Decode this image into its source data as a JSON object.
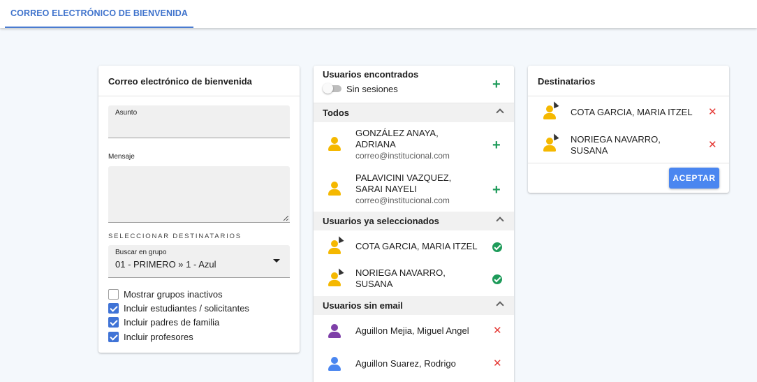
{
  "tab": {
    "label": "CORREO ELECTRÓNICO DE BIENVENIDA"
  },
  "welcome": {
    "title": "Correo electrónico de bienvenida",
    "subject_label": "Asunto",
    "subject_value": "",
    "message_label": "Mensaje",
    "message_value": "",
    "recipients_caption": "SELECCIONAR DESTINATARIOS",
    "group_select": {
      "label": "Buscar en grupo",
      "value": "01 - PRIMERO » 1 - Azul"
    },
    "checkboxes": [
      {
        "label": "Mostrar grupos inactivos",
        "checked": false
      },
      {
        "label": "Incluir estudiantes / solicitantes",
        "checked": true
      },
      {
        "label": "Incluir padres de familia",
        "checked": true
      },
      {
        "label": "Incluir profesores",
        "checked": true
      }
    ]
  },
  "users": {
    "title": "Usuarios encontrados",
    "toggle_label": "Sin sesiones",
    "toggle_on": false,
    "add_icon": "plus-icon",
    "groups": {
      "todos": {
        "label": "Todos",
        "items": [
          {
            "name_line1": "GONZÁLEZ ANAYA,",
            "name_line2": "ADRIANA",
            "email": "correo@institucional.com"
          },
          {
            "name_line1": "PALAVICINI VAZQUEZ,",
            "name_line2": "SARAI NAYELI",
            "email": "correo@institucional.com"
          }
        ]
      },
      "selected": {
        "label": "Usuarios ya seleccionados",
        "items": [
          {
            "name_line1": "COTA GARCIA, MARIA ITZEL"
          },
          {
            "name_line1": "NORIEGA NAVARRO,",
            "name_line2": "SUSANA"
          }
        ]
      },
      "no_email": {
        "label": "Usuarios sin email",
        "items": [
          {
            "name_line1": "Aguillon Mejia, Miguel Angel"
          },
          {
            "name_line1": "Aguillon Suarez, Rodrigo"
          }
        ]
      }
    }
  },
  "recipients": {
    "title": "Destinatarios",
    "items": [
      {
        "name_line1": "COTA GARCIA, MARIA ITZEL"
      },
      {
        "name_line1": "NORIEGA NAVARRO,",
        "name_line2": "SUSANA"
      }
    ],
    "accept_label": "ACEPTAR"
  },
  "colors": {
    "accent": "#3f73cc",
    "button": "#4a86f0",
    "add_green": "#1e9b5a",
    "remove_red": "#e53935",
    "user_yellow": "#f5b800",
    "user_purple": "#7e3fa8",
    "user_blue": "#4a86f0"
  },
  "icons": [
    "user-icon",
    "user-selected-icon",
    "check-circle-icon",
    "close-icon",
    "chevron-up-icon",
    "dropdown-arrow-icon"
  ]
}
